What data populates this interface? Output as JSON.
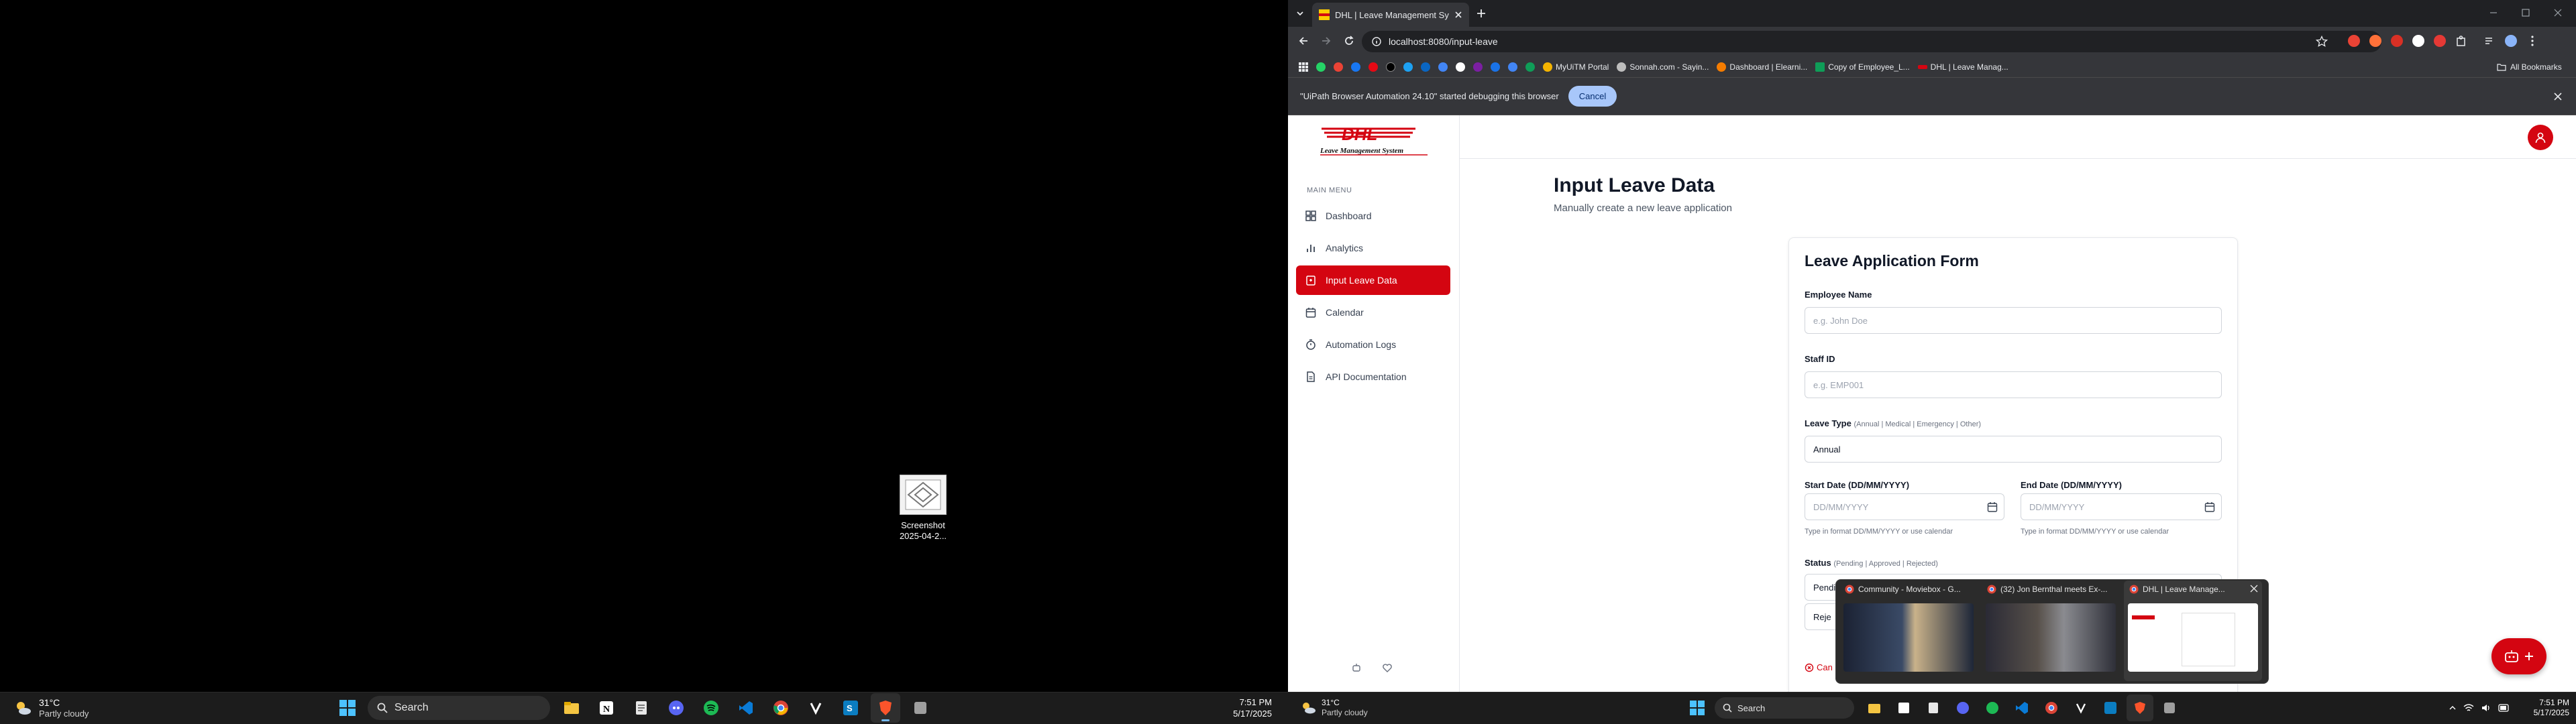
{
  "colors": {
    "dhl_red": "#d40511",
    "dhl_yellow": "#ffcc00",
    "chrome_dark": "#202124",
    "chrome_mid": "#35363a"
  },
  "desktop_left": {
    "icon": {
      "name": "Screenshot",
      "name2": "2025-04-2..."
    },
    "taskbar": {
      "weather": {
        "temp": "31°C",
        "desc": "Partly cloudy"
      },
      "search_label": "Search",
      "apps": [
        "file-explorer-icon",
        "notion-icon",
        "notepad-icon",
        "discord-icon",
        "spotify-icon",
        "vscode-icon",
        "chrome-icon",
        "uipath-studio-icon",
        "uipath-assistant-icon",
        "brave-icon",
        "app-icon"
      ],
      "clock": {
        "time": "7:51 PM",
        "date": "5/17/2025"
      }
    }
  },
  "browser": {
    "tab_title": "DHL | Leave Management Syste",
    "url": "localhost:8080/input-leave",
    "bookmarks": [
      "MyUiTM Portal",
      "Sonnah.com - Sayin...",
      "Dashboard | Elearni...",
      "Copy of Employee_L...",
      "DHL | Leave Manag..."
    ],
    "all_bookmarks": "All Bookmarks",
    "infobar_text": "\"UiPath Browser Automation 24.10\" started debugging this browser",
    "infobar_cancel": "Cancel"
  },
  "app": {
    "logo_text": "DHL",
    "logo_sub": "Leave Management System",
    "menu_label": "MAIN MENU",
    "nav": [
      {
        "label": "Dashboard",
        "icon": "dashboard-icon"
      },
      {
        "label": "Analytics",
        "icon": "bar-chart-icon"
      },
      {
        "label": "Input Leave Data",
        "icon": "clipboard-icon",
        "active": true
      },
      {
        "label": "Calendar",
        "icon": "calendar-icon"
      },
      {
        "label": "Automation Logs",
        "icon": "timer-icon"
      },
      {
        "label": "API Documentation",
        "icon": "document-icon"
      }
    ],
    "page_title": "Input Leave Data",
    "page_subtitle": "Manually create a new leave application",
    "form": {
      "title": "Leave Application Form",
      "employee_name_label": "Employee Name",
      "employee_name_placeholder": "e.g. John Doe",
      "staff_id_label": "Staff ID",
      "staff_id_placeholder": "e.g. EMP001",
      "leave_type_label": "Leave Type",
      "leave_type_hint": "(Annual | Medical | Emergency | Other)",
      "leave_type_value": "Annual",
      "start_date_label": "Start Date (DD/MM/YYYY)",
      "start_date_placeholder": "DD/MM/YYYY",
      "end_date_label": "End Date (DD/MM/YYYY)",
      "end_date_placeholder": "DD/MM/YYYY",
      "date_help": "Type in format DD/MM/YYYY or use calendar",
      "status_label": "Status",
      "status_hint": "(Pending | Approved | Rejected)",
      "status_value": "Pendi",
      "status_option_partial": "Reje",
      "cancel_partial": "Can"
    }
  },
  "thumbnails": [
    {
      "title": "Community - Moviebox - G...",
      "icon": "chrome-icon"
    },
    {
      "title": "(32) Jon Bernthal meets Ex-...",
      "icon": "chrome-icon"
    },
    {
      "title": "DHL | Leave Manage...",
      "icon": "chrome-icon"
    }
  ],
  "desktop_right": {
    "taskbar": {
      "weather": {
        "temp": "31°C",
        "desc": "Partly cloudy"
      },
      "search_label": "Search",
      "clock": {
        "time": "7:51 PM",
        "date": "5/17/2025"
      }
    }
  }
}
